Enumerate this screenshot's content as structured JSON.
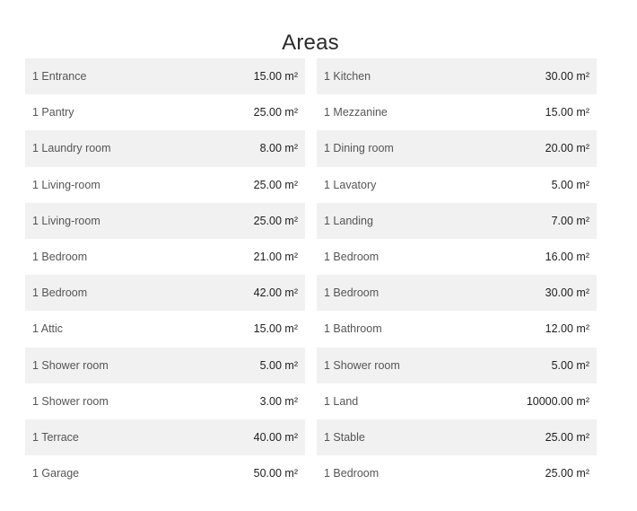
{
  "title": "Areas",
  "columns": [
    {
      "rows": [
        {
          "label": "1 Entrance",
          "value": "15.00 m²"
        },
        {
          "label": "1 Pantry",
          "value": "25.00 m²"
        },
        {
          "label": "1 Laundry room",
          "value": "8.00 m²"
        },
        {
          "label": "1 Living-room",
          "value": "25.00 m²"
        },
        {
          "label": "1 Living-room",
          "value": "25.00 m²"
        },
        {
          "label": "1 Bedroom",
          "value": "21.00 m²"
        },
        {
          "label": "1 Bedroom",
          "value": "42.00 m²"
        },
        {
          "label": "1 Attic",
          "value": "15.00 m²"
        },
        {
          "label": "1 Shower room",
          "value": "5.00 m²"
        },
        {
          "label": "1 Shower room",
          "value": "3.00 m²"
        },
        {
          "label": "1 Terrace",
          "value": "40.00 m²"
        },
        {
          "label": "1 Garage",
          "value": "50.00 m²"
        }
      ]
    },
    {
      "rows": [
        {
          "label": "1 Kitchen",
          "value": "30.00 m²"
        },
        {
          "label": "1 Mezzanine",
          "value": "15.00 m²"
        },
        {
          "label": "1 Dining room",
          "value": "20.00 m²"
        },
        {
          "label": "1 Lavatory",
          "value": "5.00 m²"
        },
        {
          "label": "1 Landing",
          "value": "7.00 m²"
        },
        {
          "label": "1 Bedroom",
          "value": "16.00 m²"
        },
        {
          "label": "1 Bedroom",
          "value": "30.00 m²"
        },
        {
          "label": "1 Bathroom",
          "value": "12.00 m²"
        },
        {
          "label": "1 Shower room",
          "value": "5.00 m²"
        },
        {
          "label": "1 Land",
          "value": "10000.00 m²"
        },
        {
          "label": "1 Stable",
          "value": "25.00 m²"
        },
        {
          "label": "1 Bedroom",
          "value": "25.00 m²"
        }
      ]
    }
  ]
}
